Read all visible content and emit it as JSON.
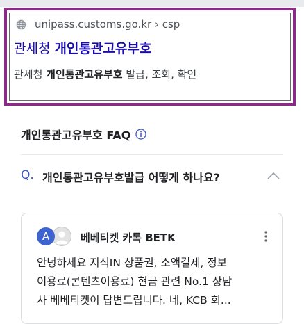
{
  "result": {
    "url": "unipass.customs.go.kr › csp",
    "title_prefix": "관세청 ",
    "title_bold": "개인통관고유부호",
    "desc_prefix": "관세청 ",
    "desc_bold": "개인통관고유부호",
    "desc_suffix": " 발급, 조회, 확인"
  },
  "faq": {
    "header": "개인통관고유부호 FAQ",
    "question_mark": "Q.",
    "question": "개인통관고유부호발급 어떻게 하나요?",
    "answer": {
      "avatar_letter": "A",
      "author": "베베티켓 카톡 BETK",
      "lines": [
        "안녕하세요 지식IN 상품권, 소액결제, 정보",
        "이용료(콘텐츠이용료) 현금 관련 No.1 상담",
        "사 베베티켓이 답변드립니다. 네, KCB 회..."
      ]
    }
  },
  "colors": {
    "highlight_border": "#8c2a8a",
    "link_blue": "#1a0dab",
    "accent_blue": "#3c55c8",
    "avatar_blue": "#3d63d1"
  }
}
